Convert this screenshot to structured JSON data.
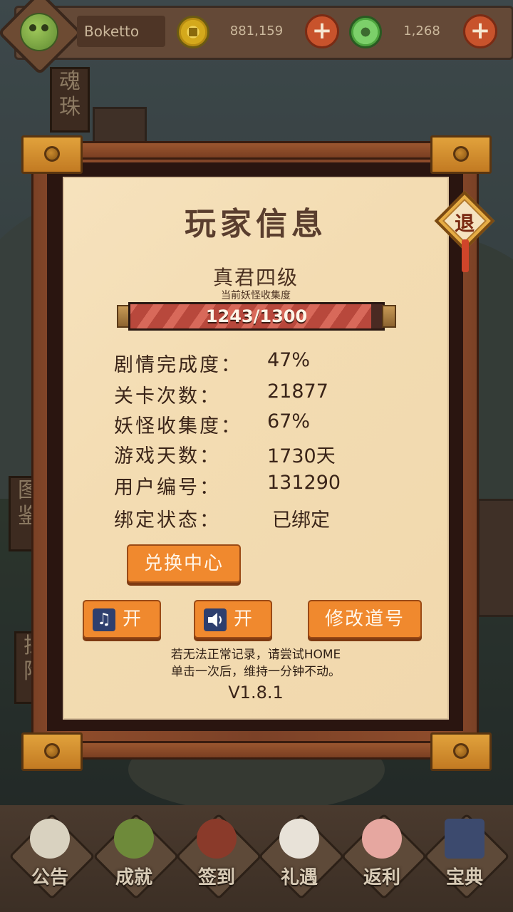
{
  "top_bar": {
    "player_name": "Boketto",
    "gold_amount": "881,159",
    "jade_amount": "1,268",
    "plus_label": "+"
  },
  "side_tabs": {
    "top": "魂珠",
    "middle": "图鉴",
    "lower": "探险"
  },
  "dialog": {
    "title": "玩家信息",
    "rank": "真君四级",
    "rank_subtitle": "当前妖怪收集度",
    "progress": {
      "current": 1243,
      "max": 1300,
      "text": "1243/1300"
    },
    "stats": [
      {
        "label": "剧情完成度：",
        "value": "47%"
      },
      {
        "label": "关卡次数：",
        "value": "21877"
      },
      {
        "label": "妖怪收集度：",
        "value": "67%"
      },
      {
        "label": "游戏天数：",
        "value": "1730天"
      },
      {
        "label": "用户编号：",
        "value": "131290"
      },
      {
        "label": "绑定状态：",
        "value": "已绑定"
      }
    ],
    "buttons": {
      "exchange": "兑换中心",
      "music": "开",
      "sound": "开",
      "rename": "修改道号"
    },
    "note_line1": "若无法正常记录，请尝试HOME",
    "note_line2": "单击一次后，维持一分钟不动。",
    "version": "V1.8.1",
    "exit_label": "退"
  },
  "bottom_nav": [
    {
      "label": "公告",
      "icon": "notice-icon"
    },
    {
      "label": "成就",
      "icon": "achievement-icon"
    },
    {
      "label": "签到",
      "icon": "checkin-icon"
    },
    {
      "label": "礼遇",
      "icon": "gift-icon"
    },
    {
      "label": "返利",
      "icon": "rebate-icon"
    },
    {
      "label": "宝典",
      "icon": "book-icon"
    }
  ],
  "colors": {
    "button_orange": "#f0892e",
    "paper": "#f3dcb2",
    "frame_wood": "#8e4c2b",
    "progress_fill": "#c85a4a"
  }
}
